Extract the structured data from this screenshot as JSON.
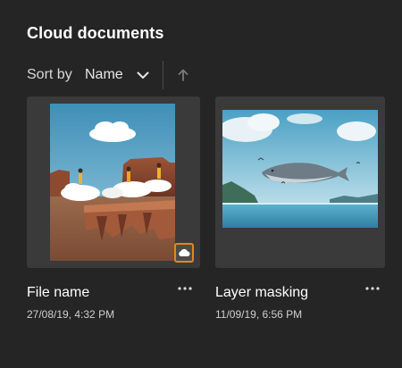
{
  "header": {
    "title": "Cloud documents"
  },
  "sort": {
    "label": "Sort by",
    "selected": "Name"
  },
  "documents": [
    {
      "name": "File name",
      "date": "27/08/19, 4:32 PM"
    },
    {
      "name": "Layer masking",
      "date": "11/09/19, 6:56 PM"
    }
  ],
  "colors": {
    "background": "#252525",
    "card": "#3a3a3a",
    "badge_border": "#e68619"
  },
  "icons": {
    "sort_chevron": "chevron-down-icon",
    "sort_direction": "arrow-up-icon",
    "cloud_badge": "cloud-icon",
    "more": "more-horizontal-icon"
  }
}
